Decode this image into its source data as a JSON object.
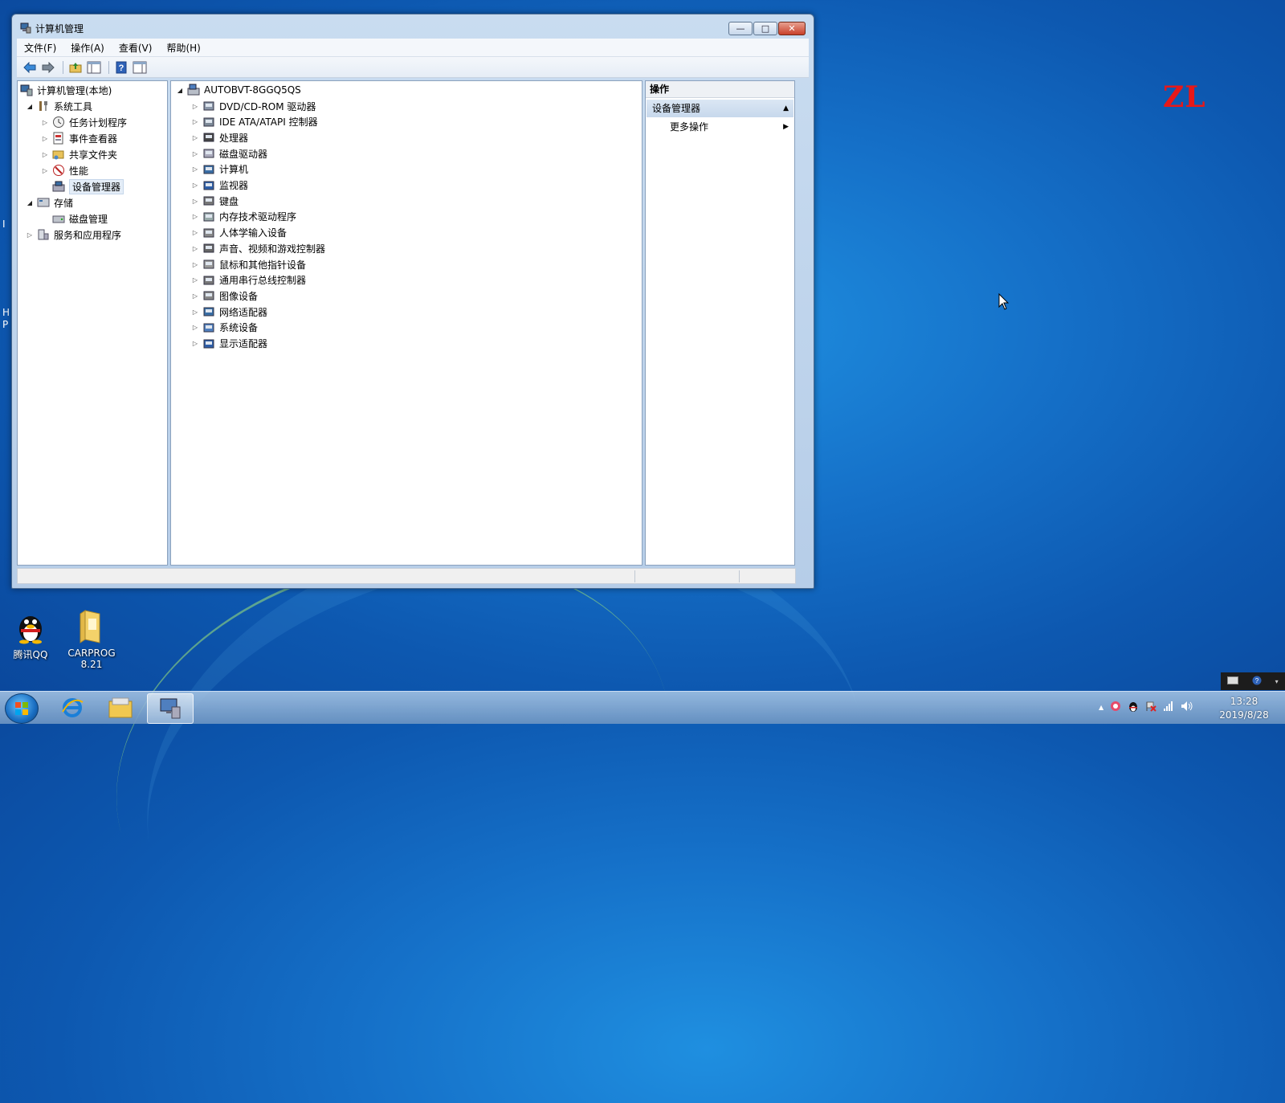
{
  "window": {
    "title": "计算机管理",
    "controls": {
      "minimize": "—",
      "maximize": "□",
      "close": "✕"
    }
  },
  "menu": [
    "文件(F)",
    "操作(A)",
    "查看(V)",
    "帮助(H)"
  ],
  "nav_tree": {
    "root": "计算机管理(本地)",
    "system_tools": "系统工具",
    "task_scheduler": "任务计划程序",
    "event_viewer": "事件查看器",
    "shared_folders": "共享文件夹",
    "performance": "性能",
    "device_manager": "设备管理器",
    "storage": "存储",
    "disk_management": "磁盘管理",
    "services_apps": "服务和应用程序"
  },
  "device_tree": {
    "computer_name": "AUTOBVT-8GGQ5QS",
    "categories": [
      "DVD/CD-ROM 驱动器",
      "IDE ATA/ATAPI 控制器",
      "处理器",
      "磁盘驱动器",
      "计算机",
      "监视器",
      "键盘",
      "内存技术驱动程序",
      "人体学输入设备",
      "声音、视频和游戏控制器",
      "鼠标和其他指针设备",
      "通用串行总线控制器",
      "图像设备",
      "网络适配器",
      "系统设备",
      "显示适配器"
    ]
  },
  "actions": {
    "header": "操作",
    "section": "设备管理器",
    "more": "更多操作"
  },
  "desktop": {
    "qq_label": "腾讯QQ",
    "carprog_label_1": "CARPROG",
    "carprog_label_2": "8.21",
    "watermark": "ZL",
    "edge_letters": [
      "I",
      "H",
      "P"
    ]
  },
  "taskbar": {
    "time": "13:28",
    "date": "2019/8/28",
    "tray_expand": "▲"
  },
  "colors": {
    "selection_bg": "#e4edf7",
    "watermark": "#e81818",
    "close_button": "#c8402a"
  }
}
